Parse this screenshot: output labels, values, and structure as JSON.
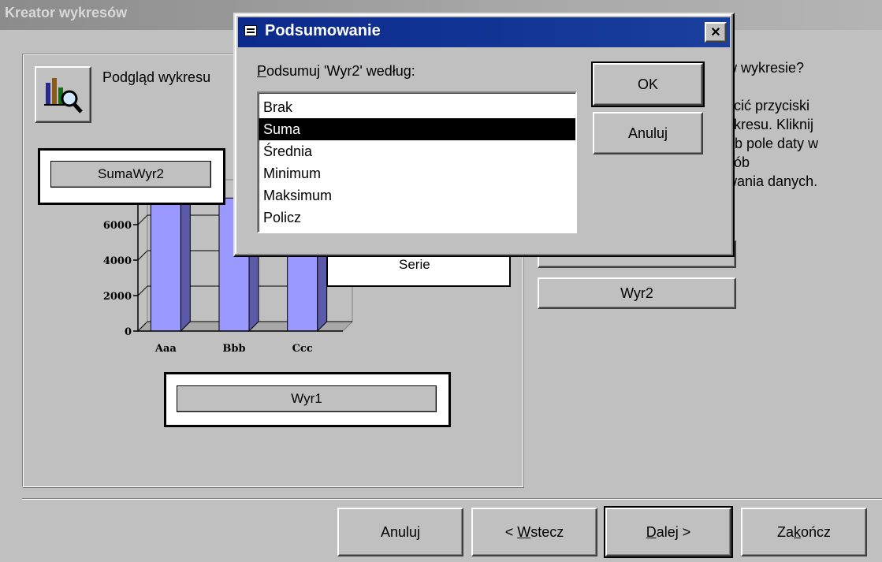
{
  "wizard": {
    "title": "Kreator wykresów",
    "preview_label": "Podgląd wykresu",
    "hint_lines": [
      "w wykresie?",
      "",
      "ścić przyciski",
      "ykresu. Kliknij",
      "ub pole daty w",
      "sób",
      "wania danych."
    ],
    "field_suma": "SumaWyr2",
    "field_seria": "Serie",
    "field_wyr1": "Wyr1",
    "field_wyr2": "Wyr2",
    "buttons": {
      "cancel": "Anuluj",
      "back_prefix": "< ",
      "back_u": "W",
      "back_rest": "stecz",
      "next_u": "D",
      "next_rest": "alej >",
      "finish_pre": "Za",
      "finish_u": "k",
      "finish_rest": "ończ"
    }
  },
  "chart_data": {
    "type": "bar",
    "categories": [
      "Aaa",
      "Bbb",
      "Ccc"
    ],
    "values": [
      7500,
      7500,
      7500
    ],
    "y_ticks": [
      "0",
      "2000",
      "4000",
      "6000"
    ],
    "ylim": [
      0,
      8000
    ],
    "bar_color": "#9999ff"
  },
  "dialog": {
    "title": "Podsumowanie",
    "prompt_u": "P",
    "prompt_rest": "odsumuj 'Wyr2' według:",
    "options": [
      "Brak",
      "Suma",
      "Średnia",
      "Minimum",
      "Maksimum",
      "Policz"
    ],
    "selected": "Suma",
    "ok": "OK",
    "cancel": "Anuluj",
    "close_glyph": "✕"
  }
}
